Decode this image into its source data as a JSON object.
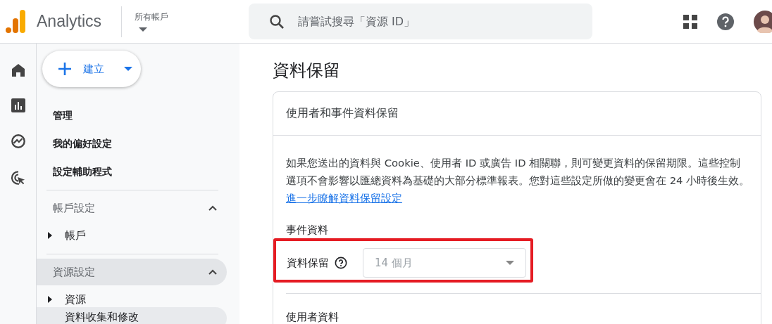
{
  "header": {
    "product": "Analytics",
    "account_label": "所有帳戶",
    "search": {
      "placeholder": "請嘗試搜尋「資源 ID」"
    }
  },
  "create_button": {
    "label": "建立"
  },
  "sidebar": {
    "items": [
      {
        "kind": "link",
        "label": "管理"
      },
      {
        "kind": "link",
        "label": "我的偏好設定"
      },
      {
        "kind": "link",
        "label": "設定輔助程式"
      },
      {
        "kind": "section",
        "label": "帳戶設定",
        "expanded": true,
        "selected": false
      },
      {
        "kind": "node",
        "label": "帳戶",
        "expanded": false,
        "selected": false
      },
      {
        "kind": "section",
        "label": "資源設定",
        "expanded": true,
        "selected": true
      },
      {
        "kind": "node",
        "label": "資源",
        "expanded": false,
        "selected": false
      },
      {
        "kind": "child",
        "label": "資料收集和修改",
        "selected": true
      }
    ]
  },
  "page": {
    "title": "資料保留",
    "card": {
      "title": "使用者和事件資料保留",
      "description": "如果您送出的資料與 Cookie、使用者 ID 或廣告 ID 相關聯，則可變更資料的保留期限。這些控制選項不會影響以匯總資料為基礎的大部分標準報表。您對這些設定所做的變更會在 24 小時後生效。",
      "learn_more": "進一步瞭解資料保留設定",
      "event_section": "事件資料",
      "retention": {
        "label": "資料保留",
        "value": "14 個月",
        "disabled": true,
        "highlighted": true
      },
      "user_section": "使用者資料"
    }
  }
}
